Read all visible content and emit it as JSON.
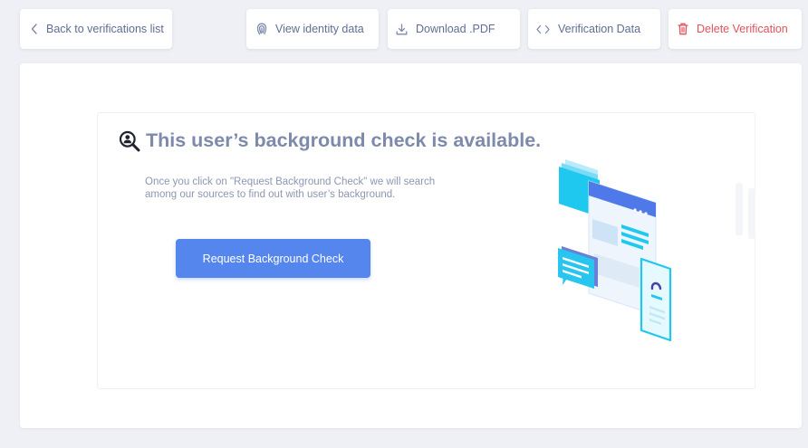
{
  "toolbar": {
    "back_label": "Back to verifications list",
    "identity_label": "View identity data",
    "pdf_label": "Download .PDF",
    "verification_data_label": "Verification Data",
    "delete_label": "Delete Verification"
  },
  "main": {
    "title": "This user’s background check is available.",
    "description": "Once you click on \"Request Background Check\" we will search among our sources to find out with user’s background.",
    "cta_label": "Request Background Check"
  },
  "colors": {
    "page_bg": "#eef0f5",
    "text_muted": "#5e6f93",
    "title": "#7e8aab",
    "danger": "#e0535b",
    "primary": "#5486ee",
    "illustration_accent": "#1ec8ee"
  },
  "icons": {
    "back": "chevron-left-icon",
    "identity": "fingerprint-icon",
    "pdf": "download-icon",
    "verification_data": "code-icon",
    "delete": "trash-icon",
    "title": "magnify-user-icon"
  }
}
